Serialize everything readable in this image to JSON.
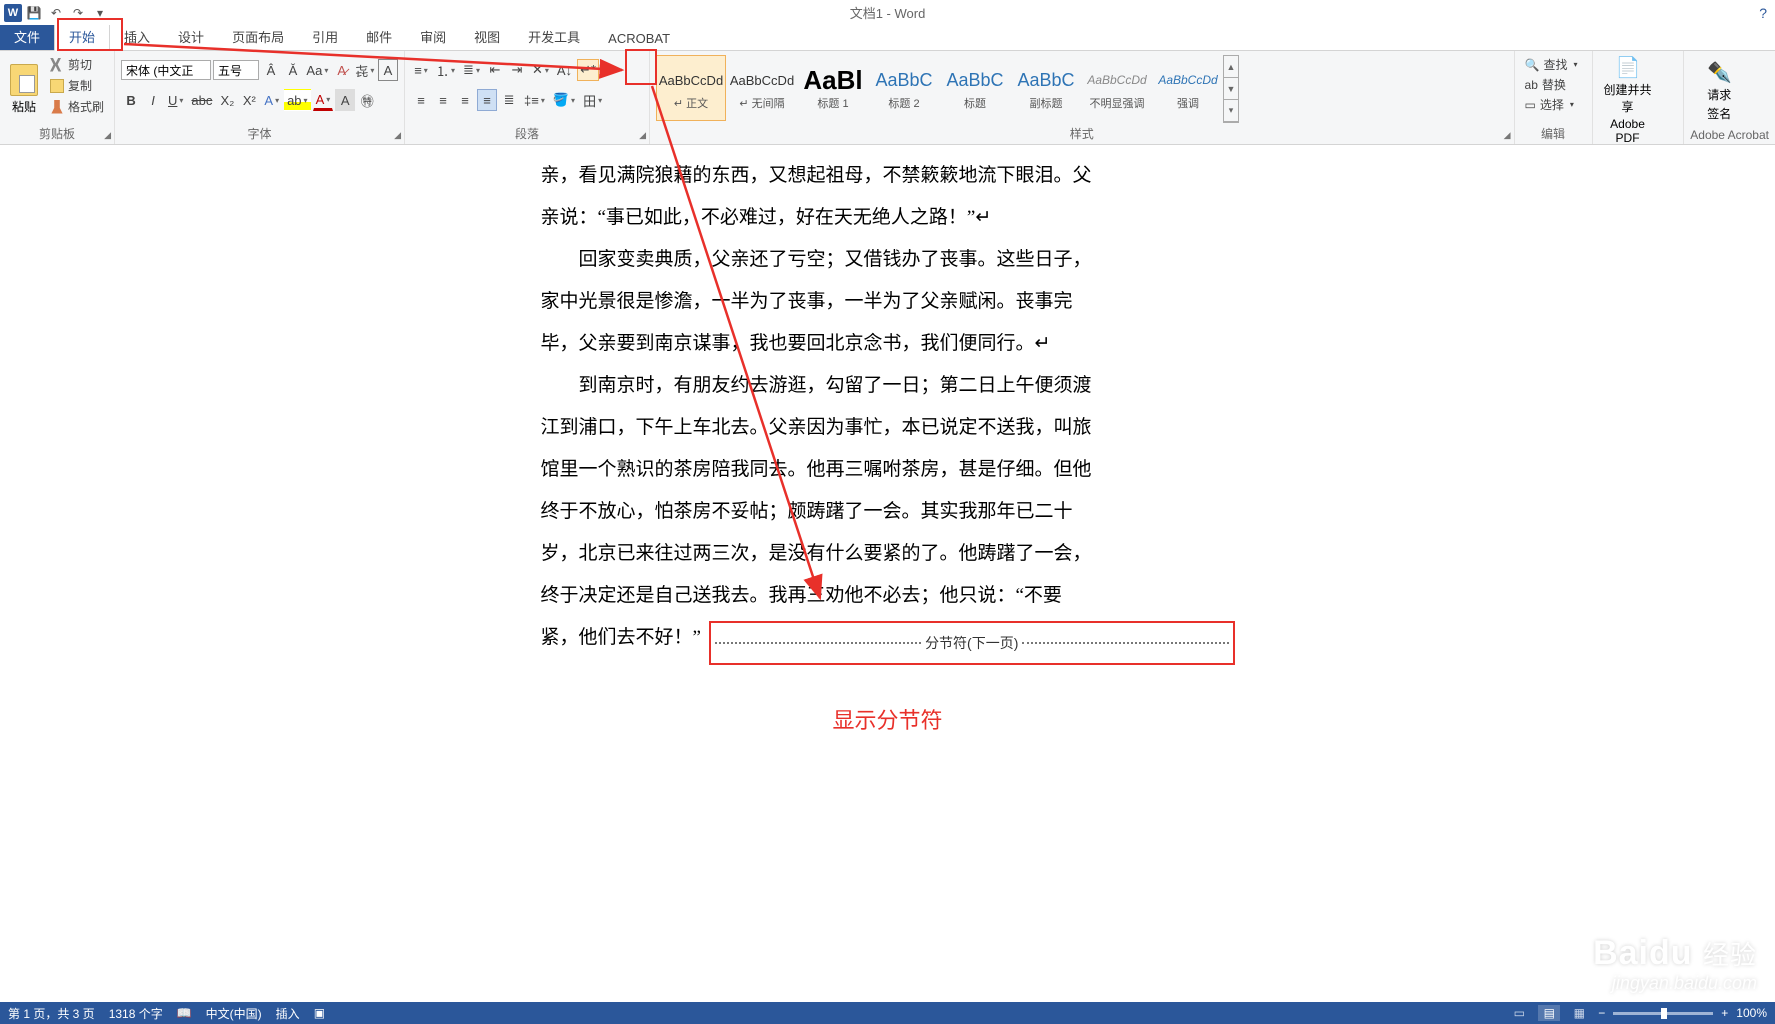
{
  "title": "文档1 - Word",
  "qat": {
    "save": "保存",
    "undo": "撤销",
    "redo": "重做"
  },
  "tabs": {
    "file": "文件",
    "home": "开始",
    "insert": "插入",
    "design": "设计",
    "layout": "页面布局",
    "references": "引用",
    "mailings": "邮件",
    "review": "审阅",
    "view": "视图",
    "developer": "开发工具",
    "acrobat": "ACROBAT"
  },
  "ribbon": {
    "clipboard": {
      "label": "剪贴板",
      "paste": "粘贴",
      "cut": "剪切",
      "copy": "复制",
      "format_painter": "格式刷"
    },
    "font": {
      "label": "字体",
      "name": "宋体 (中文正",
      "size": "五号"
    },
    "paragraph": {
      "label": "段落"
    },
    "styles": {
      "label": "样式",
      "items": [
        {
          "preview": "AaBbCcDd",
          "name": "↵ 正文",
          "previewClass": "p-normal"
        },
        {
          "preview": "AaBbCcDd",
          "name": "↵ 无间隔",
          "previewClass": "p-normal"
        },
        {
          "preview": "AaBl",
          "name": "标题 1",
          "previewClass": "p-h1"
        },
        {
          "preview": "AaBbC",
          "name": "标题 2",
          "previewClass": "p-h2"
        },
        {
          "preview": "AaBbC",
          "name": "标题",
          "previewClass": "p-h2"
        },
        {
          "preview": "AaBbC",
          "name": "副标题",
          "previewClass": "p-h2"
        },
        {
          "preview": "AaBbCcDd",
          "name": "不明显强调",
          "previewClass": "p-em1"
        },
        {
          "preview": "AaBbCcDd",
          "name": "强调",
          "previewClass": "p-em2"
        }
      ]
    },
    "editing": {
      "label": "编辑",
      "find": "查找",
      "replace": "替换",
      "select": "选择"
    },
    "adobe1": {
      "label": "Adobe Acrobat",
      "create_share_l1": "创建并共享",
      "create_share_l2": "Adobe PDF"
    },
    "adobe2": {
      "label": "Adobe Acrobat",
      "signature_l1": "请求",
      "signature_l2": "签名"
    }
  },
  "document": {
    "para1a": "亲，看见满院狼藉的东西，又想起祖母，不禁簌簌地流下眼泪。父",
    "para1b": "亲说：“事已如此，不必难过，好在天无绝人之路！”↵",
    "para2a": "回家变卖典质，父亲还了亏空；又借钱办了丧事。这些日子，",
    "para2b": "家中光景很是惨澹，一半为了丧事，一半为了父亲赋闲。丧事完",
    "para2c": "毕，父亲要到南京谋事，我也要回北京念书，我们便同行。↵",
    "para3a": "到南京时，有朋友约去游逛，勾留了一日；第二日上午便须渡",
    "para3b": "江到浦口，下午上车北去。父亲因为事忙，本已说定不送我，叫旅",
    "para3c": "馆里一个熟识的茶房陪我同去。他再三嘱咐茶房，甚是仔细。但他",
    "para3d": "终于不放心，怕茶房不妥帖；颇踌躇了一会。其实我那年已二十",
    "para3e": "岁，北京已来往过两三次，是没有什么要紧的了。他踌躇了一会，",
    "para3f": "终于决定还是自己送我去。我再三劝他不必去；他只说：“不要",
    "para3g_prefix": "紧，他们去不好！”",
    "section_break": "分节符(下一页)",
    "caption": "显示分节符"
  },
  "statusbar": {
    "page": "第 1 页，共 3 页",
    "words": "1318 个字",
    "language": "中文(中国)",
    "mode": "插入",
    "zoom": "100%"
  },
  "watermark": {
    "l1a": "Baidu",
    "l1b": "经验",
    "l2": "jingyan.baidu.com"
  }
}
